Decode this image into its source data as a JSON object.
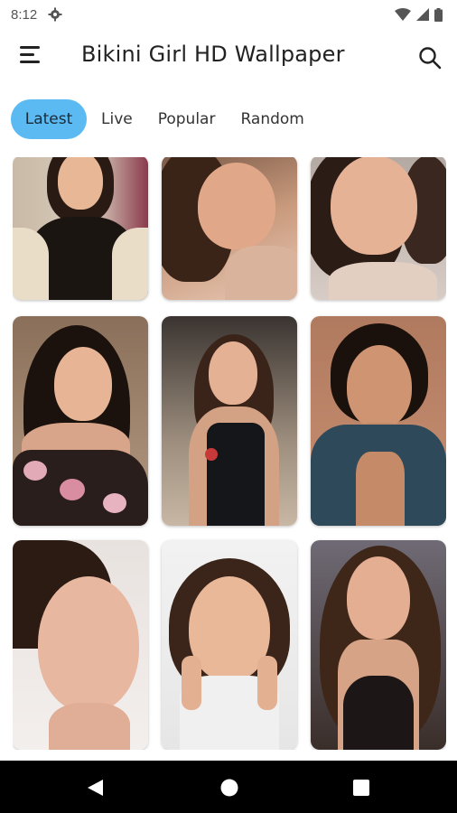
{
  "status": {
    "time": "8:12"
  },
  "app": {
    "title": "Bikini Girl HD Wallpaper"
  },
  "tabs": [
    {
      "label": "Latest",
      "active": true
    },
    {
      "label": "Live",
      "active": false
    },
    {
      "label": "Popular",
      "active": false
    },
    {
      "label": "Random",
      "active": false
    }
  ],
  "icons": {
    "menu": "menu-icon",
    "search": "search-icon",
    "settings": "gear-icon",
    "wifi": "wifi-icon",
    "signal": "signal-icon",
    "battery": "battery-icon",
    "back": "back-triangle-icon",
    "home": "home-circle-icon",
    "recents": "recents-square-icon"
  },
  "colors": {
    "active_tab": "#5bbaf2",
    "nav_bar": "#000000",
    "background": "#ffffff"
  },
  "wallpapers_count_visible": 9
}
